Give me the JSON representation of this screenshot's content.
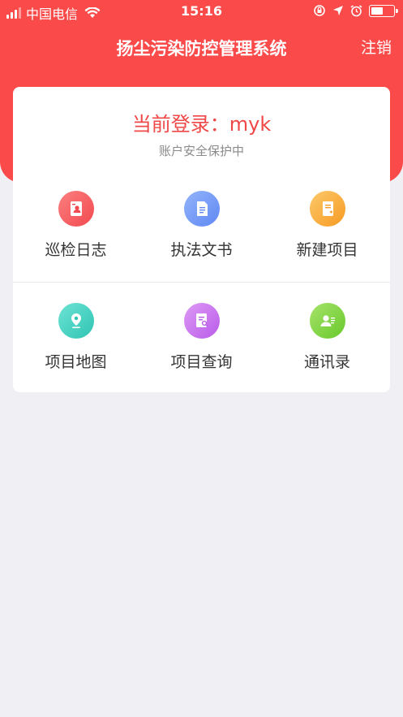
{
  "status_bar": {
    "carrier": "中国电信",
    "time": "15:16"
  },
  "header": {
    "title": "扬尘污染防控管理系统",
    "logout_label": "注销"
  },
  "login": {
    "current_login": "当前登录：myk",
    "security_note": "账户安全保护中"
  },
  "menu": {
    "items": [
      {
        "label": "巡检日志",
        "icon": "patrol-log-icon",
        "color": "#f5555b"
      },
      {
        "label": "执法文书",
        "icon": "document-icon",
        "color": "#6d95f7"
      },
      {
        "label": "新建项目",
        "icon": "new-project-icon",
        "color": "#f9aa36"
      },
      {
        "label": "项目地图",
        "icon": "map-pin-icon",
        "color": "#3ccfbf"
      },
      {
        "label": "项目查询",
        "icon": "search-document-icon",
        "color": "#c96bef"
      },
      {
        "label": "通讯录",
        "icon": "contacts-icon",
        "color": "#7ed33f"
      }
    ]
  }
}
